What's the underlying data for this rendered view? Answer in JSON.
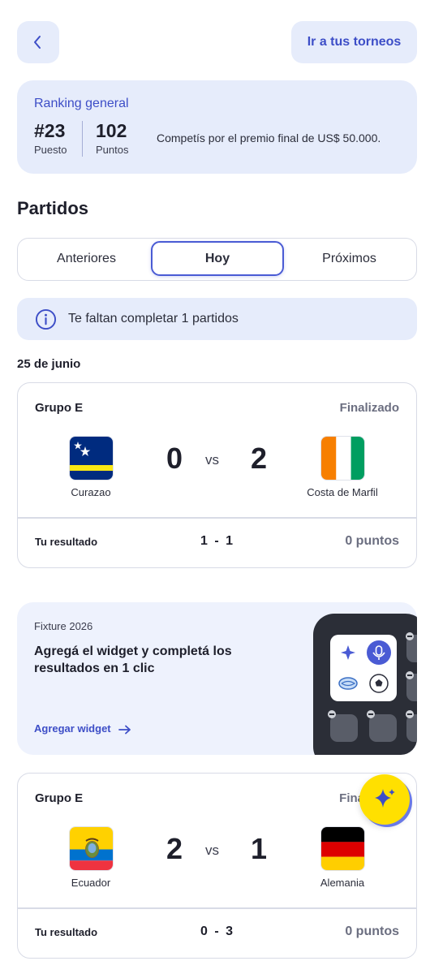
{
  "header": {
    "back_icon": "chevron-left-icon",
    "tournaments_label": "Ir a tus torneos"
  },
  "ranking": {
    "title": "Ranking general",
    "position": "#23",
    "position_label": "Puesto",
    "points": "102",
    "points_label": "Puntos",
    "description": "Competís por el premio final de US$ 50.000."
  },
  "matches_section": {
    "title": "Partidos",
    "tabs": [
      {
        "label": "Anteriores",
        "active": false
      },
      {
        "label": "Hoy",
        "active": true
      },
      {
        "label": "Próximos",
        "active": false
      }
    ],
    "info_banner": "Te faltan completar 1 partidos",
    "date": "25 de junio"
  },
  "matches": [
    {
      "group": "Grupo E",
      "status": "Finalizado",
      "home": {
        "name": "Curazao",
        "flag": "curacao-flag",
        "score": "0"
      },
      "vs": "vs",
      "away": {
        "name": "Costa de Marfil",
        "flag": "ivory-coast-flag",
        "score": "2"
      },
      "your_result_label": "Tu resultado",
      "your_result": "1 - 1",
      "points": "0 puntos"
    },
    {
      "group": "Grupo E",
      "status": "Fina",
      "home": {
        "name": "Ecuador",
        "flag": "ecuador-flag",
        "score": "2"
      },
      "vs": "vs",
      "away": {
        "name": "Alemania",
        "flag": "germany-flag",
        "score": "1"
      },
      "your_result_label": "Tu resultado",
      "your_result": "0 - 3",
      "points": "0 puntos"
    }
  ],
  "widget_promo": {
    "kicker": "Fixture 2026",
    "title": "Agregá el widget y completá los resultados en 1 clic",
    "link_label": "Agregar widget",
    "link_icon": "arrow-right-icon"
  },
  "fab": {
    "icon": "sparkle-icon"
  },
  "colors": {
    "accent": "#3d4ec7",
    "card_bg": "#e6ecfb",
    "fab": "#ffe000"
  }
}
